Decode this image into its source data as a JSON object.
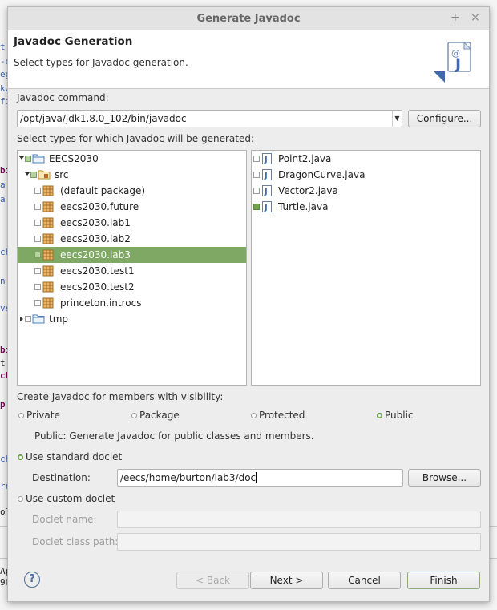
{
  "window": {
    "title": "Generate Javadoc",
    "plus_glyph": "+",
    "close_glyph": "×"
  },
  "header": {
    "title": "Javadoc Generation",
    "description": "Select types for Javadoc generation."
  },
  "command": {
    "label": "Javadoc command:",
    "value": "/opt/java/jdk1.8.0_102/bin/javadoc",
    "configure_label": "Configure..."
  },
  "types": {
    "label": "Select types for which Javadoc will be generated:",
    "tree": [
      {
        "label": "EECS2030",
        "kind": "project"
      },
      {
        "label": "src",
        "kind": "folder"
      },
      {
        "label": "(default package)",
        "kind": "package"
      },
      {
        "label": "eecs2030.future",
        "kind": "package"
      },
      {
        "label": "eecs2030.lab1",
        "kind": "package"
      },
      {
        "label": "eecs2030.lab2",
        "kind": "package"
      },
      {
        "label": "eecs2030.lab3",
        "kind": "package",
        "selected": true
      },
      {
        "label": "eecs2030.test1",
        "kind": "package"
      },
      {
        "label": "eecs2030.test2",
        "kind": "package"
      },
      {
        "label": "princeton.introcs",
        "kind": "package"
      },
      {
        "label": "tmp",
        "kind": "project"
      }
    ],
    "files": [
      {
        "label": "Point2.java",
        "checked": false
      },
      {
        "label": "DragonCurve.java",
        "checked": false
      },
      {
        "label": "Vector2.java",
        "checked": false
      },
      {
        "label": "Turtle.java",
        "checked": true
      }
    ]
  },
  "visibility": {
    "label": "Create Javadoc for members with visibility:",
    "options": [
      "Private",
      "Package",
      "Protected",
      "Public"
    ],
    "selected": "Public",
    "description": "Public: Generate Javadoc for public classes and members."
  },
  "doclet": {
    "standard_label": "Use standard doclet",
    "destination_label": "Destination:",
    "destination_value": "/eecs/home/burton/lab3/doc",
    "browse_label": "Browse...",
    "custom_label": "Use custom doclet",
    "name_label": "Doclet name:",
    "classpath_label": "Doclet class path:"
  },
  "footer": {
    "help_glyph": "?",
    "back_label": "< Back",
    "next_label": "Next >",
    "cancel_label": "Cancel",
    "finish_label": "Finish"
  },
  "colors": {
    "selection": "#7fa865",
    "link": "#4d6f99"
  }
}
